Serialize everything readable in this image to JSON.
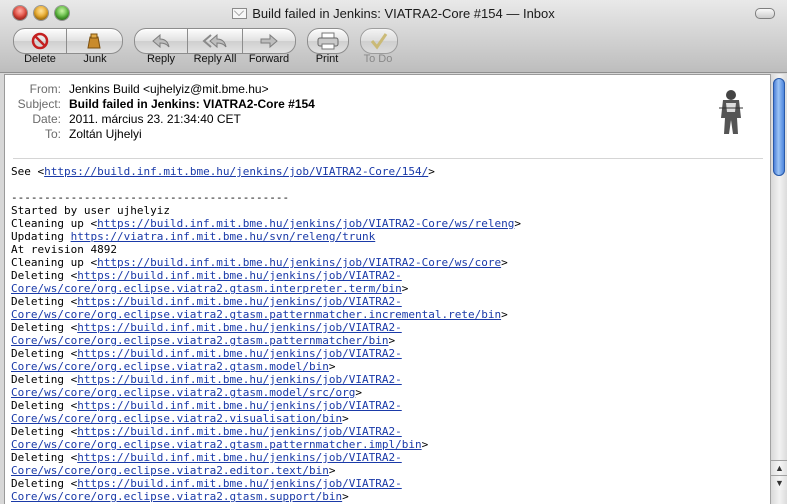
{
  "window": {
    "title": "Build failed in Jenkins: VIATRA2-Core #154 — Inbox"
  },
  "toolbar": {
    "delete": "Delete",
    "junk": "Junk",
    "reply": "Reply",
    "reply_all": "Reply All",
    "forward": "Forward",
    "print": "Print",
    "todo": "To Do"
  },
  "headers": {
    "from_label": "From:",
    "from": "Jenkins Build <ujhelyiz@mit.bme.hu>",
    "subject_label": "Subject:",
    "subject": "Build failed in Jenkins: VIATRA2-Core #154",
    "date_label": "Date:",
    "date": "2011. március 23. 21:34:40 CET",
    "to_label": "To:",
    "to": "Zoltán Ujhelyi"
  },
  "body": [
    {
      "segs": [
        [
          "See <",
          ""
        ],
        [
          "https://build.inf.mit.bme.hu/jenkins/job/VIATRA2-Core/154/",
          "link"
        ],
        [
          ">",
          ""
        ]
      ]
    },
    {
      "segs": []
    },
    {
      "segs": [
        [
          "------------------------------------------",
          ""
        ]
      ]
    },
    {
      "segs": [
        [
          "Started by user ujhelyiz",
          ""
        ]
      ]
    },
    {
      "segs": [
        [
          "Cleaning up <",
          ""
        ],
        [
          "https://build.inf.mit.bme.hu/jenkins/job/VIATRA2-Core/ws/releng",
          "link"
        ],
        [
          ">",
          ""
        ]
      ]
    },
    {
      "segs": [
        [
          "Updating ",
          ""
        ],
        [
          "https://viatra.inf.mit.bme.hu/svn/releng/trunk",
          "link"
        ]
      ]
    },
    {
      "segs": [
        [
          "At revision 4892",
          ""
        ]
      ]
    },
    {
      "segs": [
        [
          "Cleaning up <",
          ""
        ],
        [
          "https://build.inf.mit.bme.hu/jenkins/job/VIATRA2-Core/ws/core",
          "link"
        ],
        [
          ">",
          ""
        ]
      ]
    },
    {
      "segs": [
        [
          "Deleting <",
          ""
        ],
        [
          "https://build.inf.mit.bme.hu/jenkins/job/VIATRA2-",
          "link"
        ]
      ]
    },
    {
      "segs": [
        [
          "Core/ws/core/org.eclipse.viatra2.gtasm.interpreter.term/bin",
          "link"
        ],
        [
          ">",
          ""
        ]
      ]
    },
    {
      "segs": [
        [
          "Deleting <",
          ""
        ],
        [
          "https://build.inf.mit.bme.hu/jenkins/job/VIATRA2-",
          "link"
        ]
      ]
    },
    {
      "segs": [
        [
          "Core/ws/core/org.eclipse.viatra2.gtasm.patternmatcher.incremental.rete/bin",
          "link"
        ],
        [
          ">",
          ""
        ]
      ]
    },
    {
      "segs": [
        [
          "Deleting <",
          ""
        ],
        [
          "https://build.inf.mit.bme.hu/jenkins/job/VIATRA2-",
          "link"
        ]
      ]
    },
    {
      "segs": [
        [
          "Core/ws/core/org.eclipse.viatra2.gtasm.patternmatcher/bin",
          "link"
        ],
        [
          ">",
          ""
        ]
      ]
    },
    {
      "segs": [
        [
          "Deleting <",
          ""
        ],
        [
          "https://build.inf.mit.bme.hu/jenkins/job/VIATRA2-",
          "link"
        ]
      ]
    },
    {
      "segs": [
        [
          "Core/ws/core/org.eclipse.viatra2.gtasm.model/bin",
          "link"
        ],
        [
          ">",
          ""
        ]
      ]
    },
    {
      "segs": [
        [
          "Deleting <",
          ""
        ],
        [
          "https://build.inf.mit.bme.hu/jenkins/job/VIATRA2-",
          "link"
        ]
      ]
    },
    {
      "segs": [
        [
          "Core/ws/core/org.eclipse.viatra2.gtasm.model/src/org",
          "link"
        ],
        [
          ">",
          ""
        ]
      ]
    },
    {
      "segs": [
        [
          "Deleting <",
          ""
        ],
        [
          "https://build.inf.mit.bme.hu/jenkins/job/VIATRA2-",
          "link"
        ]
      ]
    },
    {
      "segs": [
        [
          "Core/ws/core/org.eclipse.viatra2.visualisation/bin",
          "link"
        ],
        [
          ">",
          ""
        ]
      ]
    },
    {
      "segs": [
        [
          "Deleting <",
          ""
        ],
        [
          "https://build.inf.mit.bme.hu/jenkins/job/VIATRA2-",
          "link"
        ]
      ]
    },
    {
      "segs": [
        [
          "Core/ws/core/org.eclipse.viatra2.gtasm.patternmatcher.impl/bin",
          "link"
        ],
        [
          ">",
          ""
        ]
      ]
    },
    {
      "segs": [
        [
          "Deleting <",
          ""
        ],
        [
          "https://build.inf.mit.bme.hu/jenkins/job/VIATRA2-",
          "link"
        ]
      ]
    },
    {
      "segs": [
        [
          "Core/ws/core/org.eclipse.viatra2.editor.text/bin",
          "link"
        ],
        [
          ">",
          ""
        ]
      ]
    },
    {
      "segs": [
        [
          "Deleting <",
          ""
        ],
        [
          "https://build.inf.mit.bme.hu/jenkins/job/VIATRA2-",
          "link"
        ]
      ]
    },
    {
      "segs": [
        [
          "Core/ws/core/org.eclipse.viatra2.gtasm.support/bin",
          "link"
        ],
        [
          ">",
          ""
        ]
      ]
    }
  ],
  "icons": {
    "delete": "delete-icon",
    "junk": "junk-bag-icon",
    "reply": "reply-arrow-icon",
    "reply_all": "reply-all-arrow-icon",
    "forward": "forward-arrow-icon",
    "print": "printer-icon",
    "todo": "checkmark-icon"
  },
  "colors": {
    "link": "#1a3aa8",
    "scroll_thumb": "#3b71d2"
  }
}
